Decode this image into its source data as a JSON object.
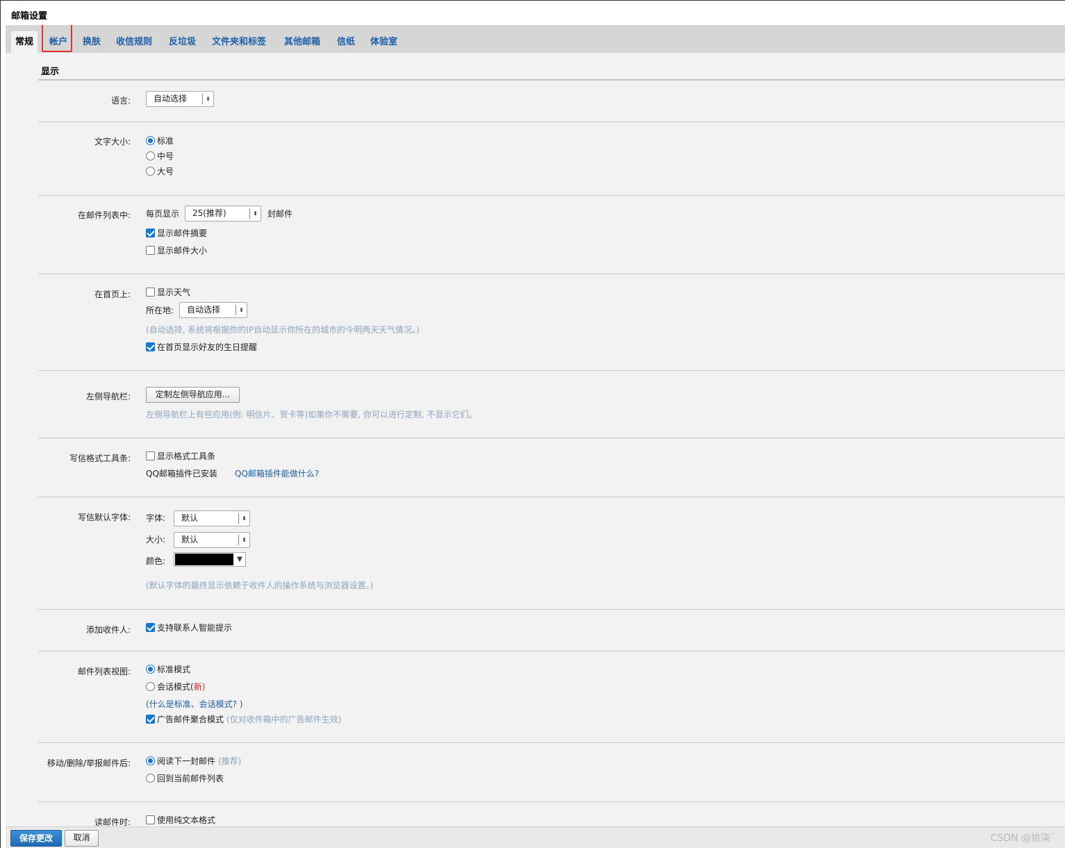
{
  "window": {
    "title": "邮箱设置"
  },
  "tabs": [
    "常规",
    "帐户",
    "换肤",
    "收信规则",
    "反垃圾",
    "文件夹和标签",
    "其他邮箱",
    "信纸",
    "体验室"
  ],
  "section": {
    "title": "显示"
  },
  "language": {
    "label": "语言:",
    "value": "自动选择"
  },
  "font_size": {
    "label": "文字大小:",
    "options": [
      "标准",
      "中号",
      "大号"
    ],
    "selected": 0
  },
  "mail_list": {
    "label": "在邮件列表中:",
    "per_page_label": "每页显示",
    "per_page_value": "25(推荐)",
    "per_page_unit": "封邮件",
    "show_summary": {
      "label": "显示邮件摘要",
      "checked": true
    },
    "show_size": {
      "label": "显示邮件大小",
      "checked": false
    }
  },
  "homepage": {
    "label": "在首页上:",
    "show_weather": {
      "label": "显示天气",
      "checked": false
    },
    "location_label": "所在地:",
    "location_value": "自动选择",
    "weather_hint": "(自动选择, 系统将根据你的IP自动显示你所在的城市的今明两天天气情况。)",
    "birthday": {
      "label": "在首页显示好友的生日提醒",
      "checked": true
    }
  },
  "left_nav": {
    "label": "左侧导航栏:",
    "button": "定制左侧导航应用...",
    "hint": "左侧导航栏上有些应用(例: 明信片、贺卡等)如果你不需要, 你可以进行定制, 不显示它们。"
  },
  "format_toolbar": {
    "label": "写信格式工具条:",
    "show": {
      "label": "显示格式工具条",
      "checked": false
    },
    "plugin_installed": "QQ邮箱插件已安装",
    "plugin_link": "QQ邮箱插件能做什么?"
  },
  "default_font": {
    "label": "写信默认字体:",
    "font_label": "字体:",
    "font_value": "默认",
    "size_label": "大小:",
    "size_value": "默认",
    "color_label": "颜色:",
    "color_value": "#000000",
    "hint": "(默认字体的最终显示依赖于收件人的操作系统与浏览器设置。)"
  },
  "add_recipient": {
    "label": "添加收件人:",
    "smart": {
      "label": "支持联系人智能提示",
      "checked": true
    }
  },
  "list_view": {
    "label": "邮件列表视图:",
    "standard": "标准模式",
    "conversation": "会话模式(",
    "conversation_new": "新",
    "conversation_close": ")",
    "selected": 0,
    "what_link": "(什么是标准、会话模式? )",
    "ad_aggregate": {
      "label": "广告邮件聚合模式",
      "checked": true,
      "note": "(仅对收件箱中的广告邮件生效)"
    }
  },
  "after_action": {
    "label": "移动/删除/举报邮件后:",
    "read_next": "阅读下一封邮件",
    "recommend": "(推荐)",
    "back_list": "回到当前邮件列表",
    "selected": 0
  },
  "reading": {
    "label": "读邮件时:",
    "plain_text": {
      "label": "使用纯文本格式",
      "checked": false
    }
  },
  "footer": {
    "save": "保存更改",
    "cancel": "取消"
  },
  "watermark": "CSDN @拾柒`",
  "colors": {
    "accent": "#1877d1",
    "link": "#1b5eaa",
    "highlight": "#e62e2e",
    "hint": "#8aa3bf"
  }
}
